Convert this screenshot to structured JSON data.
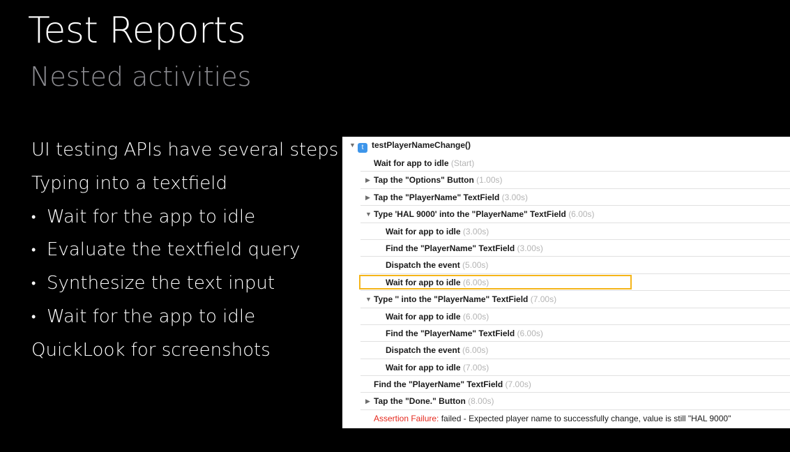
{
  "slide": {
    "title": "Test Reports",
    "subtitle": "Nested activities"
  },
  "bullets": [
    {
      "text": "UI testing APIs have several steps",
      "level": 0
    },
    {
      "text": "Typing into a textfield",
      "level": 0
    },
    {
      "text": "Wait for the app to idle",
      "level": 1
    },
    {
      "text": "Evaluate the textfield query",
      "level": 1
    },
    {
      "text": "Synthesize the text input",
      "level": 1
    },
    {
      "text": "Wait for the app to idle",
      "level": 1
    },
    {
      "text": "QuickLook for screenshots",
      "level": 0
    }
  ],
  "bullet_glyph": "•",
  "report": {
    "root": {
      "disclosure": "▼",
      "icon_letter": "t",
      "label": "testPlayerNameChange()"
    },
    "rows": [
      {
        "label": "Wait for app to idle",
        "duration": "(Start)",
        "indent": 0,
        "disclosure": ""
      },
      {
        "label": "Tap the \"Options\" Button",
        "duration": "(1.00s)",
        "indent": 0,
        "disclosure": "▶"
      },
      {
        "label": "Tap the \"PlayerName\" TextField",
        "duration": "(3.00s)",
        "indent": 0,
        "disclosure": "▶"
      },
      {
        "label": "Type 'HAL 9000' into the \"PlayerName\" TextField",
        "duration": "(6.00s)",
        "indent": 0,
        "disclosure": "▼"
      },
      {
        "label": "Wait for app to idle",
        "duration": "(3.00s)",
        "indent": 2,
        "disclosure": ""
      },
      {
        "label": "Find the \"PlayerName\" TextField",
        "duration": "(3.00s)",
        "indent": 2,
        "disclosure": ""
      },
      {
        "label": "Dispatch the event",
        "duration": "(5.00s)",
        "indent": 2,
        "disclosure": ""
      },
      {
        "label": "Wait for app to idle",
        "duration": "(6.00s)",
        "indent": 2,
        "disclosure": "",
        "highlighted": true
      },
      {
        "label": "Type '' into the \"PlayerName\" TextField",
        "duration": "(7.00s)",
        "indent": 0,
        "disclosure": "▼"
      },
      {
        "label": "Wait for app to idle",
        "duration": "(6.00s)",
        "indent": 2,
        "disclosure": ""
      },
      {
        "label": "Find the \"PlayerName\" TextField",
        "duration": "(6.00s)",
        "indent": 2,
        "disclosure": ""
      },
      {
        "label": "Dispatch the event",
        "duration": "(6.00s)",
        "indent": 2,
        "disclosure": ""
      },
      {
        "label": "Wait for app to idle",
        "duration": "(7.00s)",
        "indent": 2,
        "disclosure": ""
      },
      {
        "label": "Find the \"PlayerName\" TextField",
        "duration": "(7.00s)",
        "indent": 0,
        "disclosure": ""
      },
      {
        "label": "Tap the \"Done.\" Button",
        "duration": "(8.00s)",
        "indent": 0,
        "disclosure": "▶"
      }
    ],
    "failure": {
      "label": "Assertion Failure:",
      "message": "failed - Expected player name to successfully change, value is still \"HAL 9000\""
    }
  },
  "colors": {
    "background": "#000000",
    "subtitle": "#8e8e93",
    "icon_blue": "#3d95ea",
    "highlight": "#f5b51a",
    "failure_red": "#e5291e",
    "duration_gray": "#b4b4b4"
  }
}
